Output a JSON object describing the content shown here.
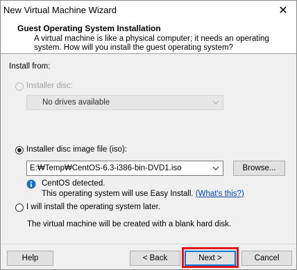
{
  "window": {
    "title": "New Virtual Machine Wizard",
    "close_glyph": "✕"
  },
  "header": {
    "title": "Guest Operating System Installation",
    "description_line1": "A virtual machine is like a physical computer; it needs an operating",
    "description_line2": "system. How will you install the guest operating system?"
  },
  "install_from_label": "Install from:",
  "options": {
    "installer_disc": {
      "label": "Installer disc:",
      "selected": false,
      "enabled": false,
      "drive_value": "No drives available"
    },
    "iso": {
      "label": "Installer disc image file (iso):",
      "selected": true,
      "path_value": "E:₩Temp₩CentOS-6.3-i386-bin-DVD1.iso",
      "browse_label": "Browse...",
      "detected_text": "CentOS detected.",
      "easy_install_text": "This operating system will use Easy Install.",
      "whats_this_link": "(What's this?)"
    },
    "later": {
      "label": "I will install the operating system later.",
      "selected": false,
      "note": "The virtual machine will be created with a blank hard disk."
    }
  },
  "footer": {
    "help_label": "Help",
    "back_label": "< Back",
    "next_label": "Next >",
    "cancel_label": "Cancel"
  },
  "colors": {
    "highlight": "#e4141d",
    "link": "#0645ad",
    "info_icon": "#1e6fc1"
  },
  "icons": {
    "info": "info-icon",
    "dropdown": "chevron-down-icon",
    "close": "close-icon"
  }
}
